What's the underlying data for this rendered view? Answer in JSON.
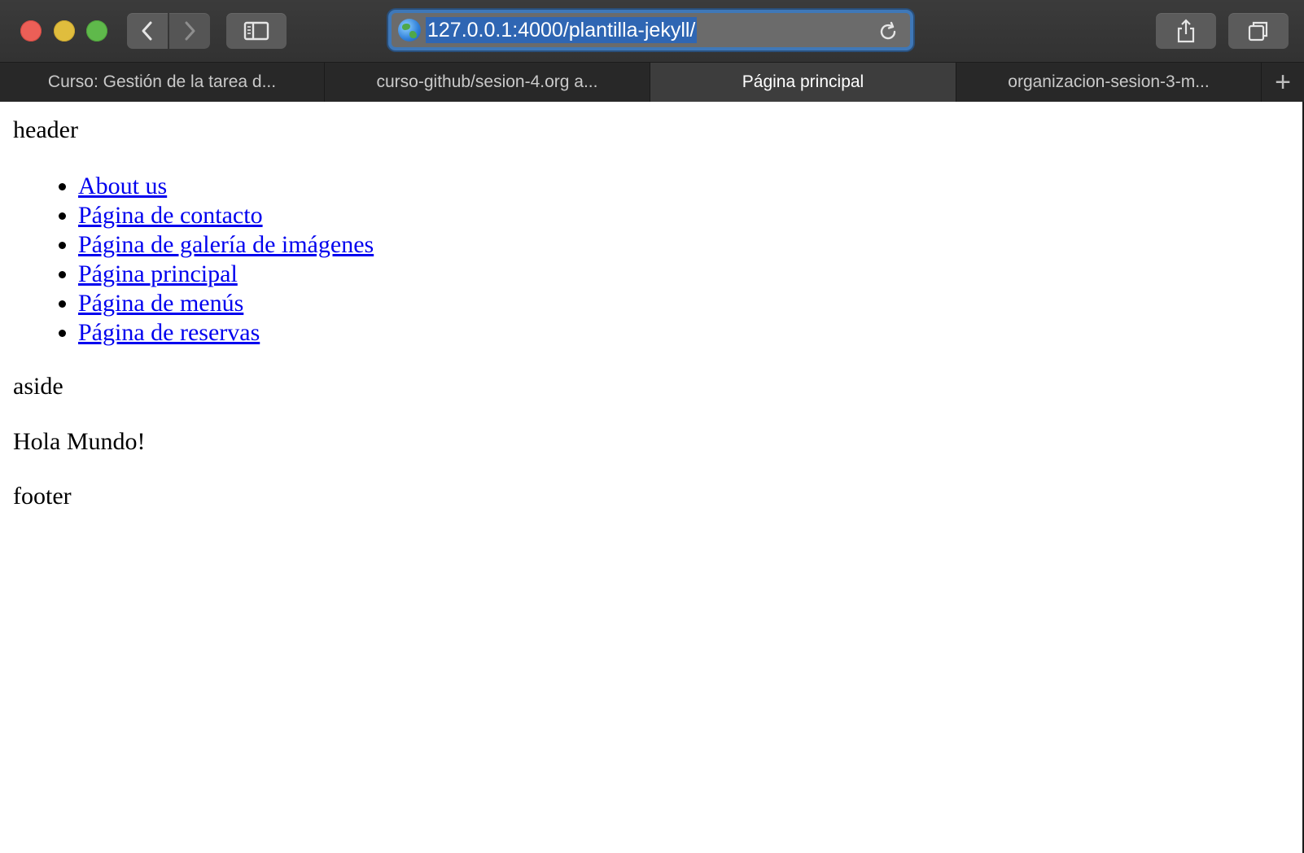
{
  "browser": {
    "url": "127.0.0.1:4000/plantilla-jekyll/",
    "tabs": [
      {
        "label": "Curso: Gestión de la tarea d..."
      },
      {
        "label": "curso-github/sesion-4.org a..."
      },
      {
        "label": "Página principal",
        "active": true
      },
      {
        "label": "organizacion-sesion-3-m..."
      }
    ],
    "new_tab_label": "+",
    "colors": {
      "selection": "#2f66b3",
      "focus_ring": "#3f78b8",
      "link": "#0000ee"
    },
    "icons": {
      "back": "chevron-left-icon",
      "forward": "chevron-right-icon",
      "sidebar": "sidebar-icon",
      "share": "share-icon",
      "tabs_overview": "tabs-overview-icon",
      "reload": "reload-icon",
      "site": "globe-icon"
    }
  },
  "page": {
    "header": "header",
    "nav": [
      {
        "label": "About us"
      },
      {
        "label": "Página de contacto"
      },
      {
        "label": "Página de galería de imágenes"
      },
      {
        "label": "Página principal"
      },
      {
        "label": "Página de menús"
      },
      {
        "label": "Página de reservas"
      }
    ],
    "aside": "aside",
    "main": "Hola Mundo!",
    "footer": "footer"
  }
}
